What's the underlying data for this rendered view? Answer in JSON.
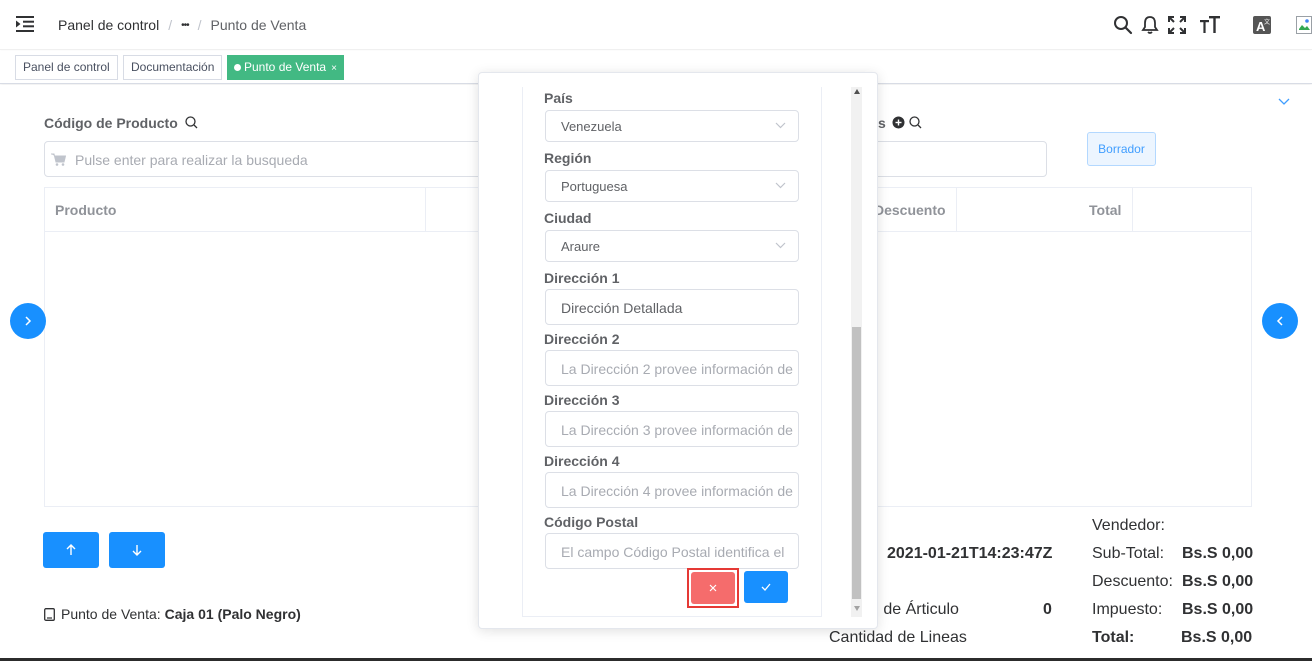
{
  "navbar": {
    "breadcrumb": {
      "home": "Panel de control",
      "separator": "/",
      "ellipsis": "•••",
      "current": "Punto de Venta"
    },
    "icons": [
      "hamburger-icon",
      "search-icon",
      "bell-icon",
      "fullscreen-icon",
      "text-size-icon",
      "translate-icon",
      "avatar-image"
    ]
  },
  "tags": [
    {
      "label": "Panel de control"
    },
    {
      "label": "Documentación"
    },
    {
      "label": "Punto de Venta",
      "close": "×"
    }
  ],
  "main": {
    "product_code_label": "Código de Producto",
    "product_search_placeholder": "Pulse enter para realizar la busqueda",
    "partial_label": "s",
    "draft_button": "Borrador",
    "table_headers": {
      "product": "Producto",
      "discount": "Descuento",
      "total": "Total"
    },
    "pos_label": "Punto de Venta:",
    "pos_value": "Caja 01 (Palo Negro)",
    "timestamp": "2021-01-21T14:23:47Z",
    "item_qty_label": "d de Árticulo",
    "item_qty_value": "0",
    "lines_qty_label": "Cantidad de Lineas",
    "summary": {
      "seller_label": "Vendedor:",
      "subtotal_label": "Sub-Total:",
      "subtotal_value": "Bs.S 0,00",
      "discount_label": "Descuento:",
      "discount_value": "Bs.S 0,00",
      "tax_label": "Impuesto:",
      "tax_value": "Bs.S 0,00",
      "total_label": "Total:",
      "total_value": "Bs.S 0,00"
    }
  },
  "modal": {
    "country_label": "País",
    "country_value": "Venezuela",
    "region_label": "Región",
    "region_value": "Portuguesa",
    "city_label": "Ciudad",
    "city_value": "Araure",
    "address1_label": "Dirección 1",
    "address1_value": "Dirección Detallada",
    "address2_label": "Dirección 2",
    "address2_placeholder": "La Dirección 2 provee información de",
    "address3_label": "Dirección 3",
    "address3_placeholder": "La Dirección 3 provee información de",
    "address4_label": "Dirección 4",
    "address4_placeholder": "La Dirección 4 provee información de",
    "postal_label": "Código Postal",
    "postal_placeholder": "El campo Código Postal identifica el"
  },
  "colors": {
    "primary": "#1890ff",
    "tag_active": "#42b983",
    "danger": "#f56c6c",
    "danger_outline": "#e53935"
  }
}
